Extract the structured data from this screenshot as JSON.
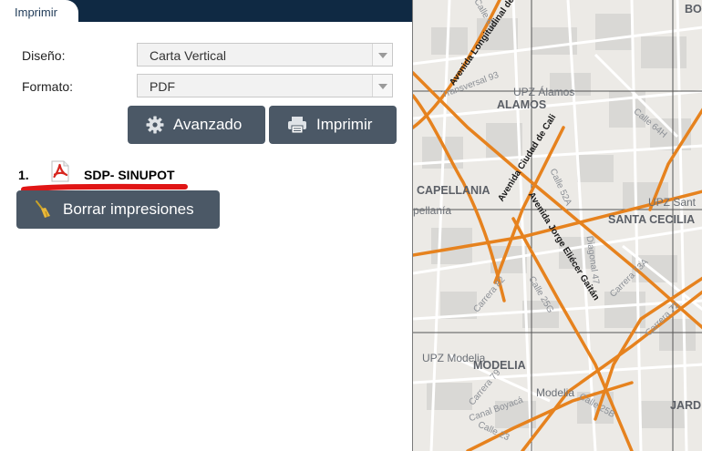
{
  "tab": {
    "label": "Imprimir"
  },
  "form": {
    "layout_label": "Diseño:",
    "layout_value": "Carta Vertical",
    "format_label": "Formato:",
    "format_value": "PDF"
  },
  "buttons": {
    "advanced": "Avanzado",
    "print": "Imprimir",
    "clear": "Borrar impresiones"
  },
  "results": [
    {
      "number": "1.",
      "name": "SDP- SINUPOT"
    }
  ],
  "map": {
    "labels": {
      "bo": "BO",
      "upz_alamos": "UPZ Álamos",
      "alamos": "ALAMOS",
      "capellania": "CAPELLANIA",
      "capellania_partial": "pellanía",
      "upz_sant": "UPZ Sant",
      "santa_cecilia": "SANTA CECILIA",
      "upz_modelia": "UPZ Modelia",
      "modelia": "MODELIA",
      "modelia_small": "Modelia",
      "jard": "JARD"
    },
    "streets": {
      "calle_63": "Calle 63",
      "transversal_93": "Transversal 93",
      "av_longitudinal": "Avenida Longitudinal de",
      "av_ciudad_cali": "Avenida Ciudad de Cali",
      "av_jorge_gaitan": "Avenida Jorge Eliécer Gaitán",
      "calle_64h": "Calle 64H",
      "calle_52a": "Calle 52A",
      "calle_25g": "Calle 25G",
      "diagonal_47": "Diagonal 47",
      "carrera_82": "Carrera 82",
      "carrera_73a": "Carrera 73A",
      "carrera_72": "Carrera 72",
      "carrera_79": "Carrera 79",
      "calle_25b": "Calle 25B",
      "calle_23": "Calle 23",
      "canal_boyaca": "Canal Boyacá"
    },
    "colors": {
      "arterial": "#e6821e",
      "base": "#eceae6",
      "block": "#d9d8d5",
      "grid": "#555555"
    }
  }
}
